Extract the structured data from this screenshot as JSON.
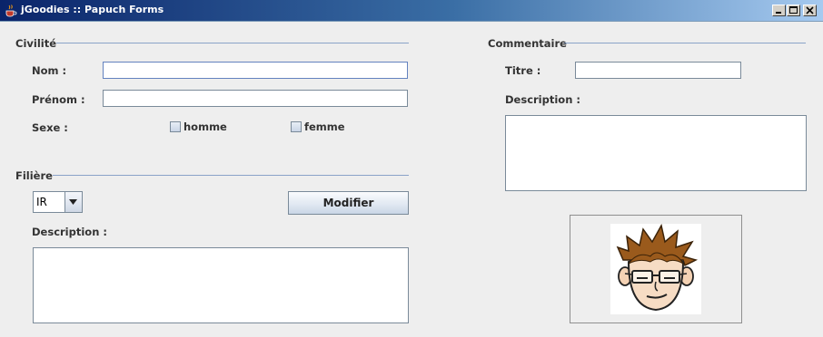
{
  "window": {
    "title": "jGoodies :: Papuch Forms",
    "icon": "java-coffee-icon",
    "controls": [
      "minimize-icon",
      "maximize-icon",
      "close-icon"
    ]
  },
  "civilite": {
    "section_title": "Civilité",
    "nom_label": "Nom :",
    "nom_value": "",
    "prenom_label": "Prénom :",
    "prenom_value": "",
    "sexe_label": "Sexe :",
    "homme_label": "homme",
    "homme_checked": false,
    "femme_label": "femme",
    "femme_checked": false
  },
  "filiere": {
    "section_title": "Filière",
    "combo_value": "IR",
    "modifier_label": "Modifier",
    "description_label": "Description :",
    "description_value": ""
  },
  "commentaire": {
    "section_title": "Commentaire",
    "titre_label": "Titre :",
    "titre_value": "",
    "description_label": "Description :",
    "description_value": ""
  },
  "avatar": {
    "icon": "cartoon-face-with-glasses-icon"
  },
  "colors": {
    "titlebar_start": "#0a246a",
    "titlebar_end": "#a6caf0",
    "separator": "#8aa3c8",
    "background": "#eeeeee"
  }
}
